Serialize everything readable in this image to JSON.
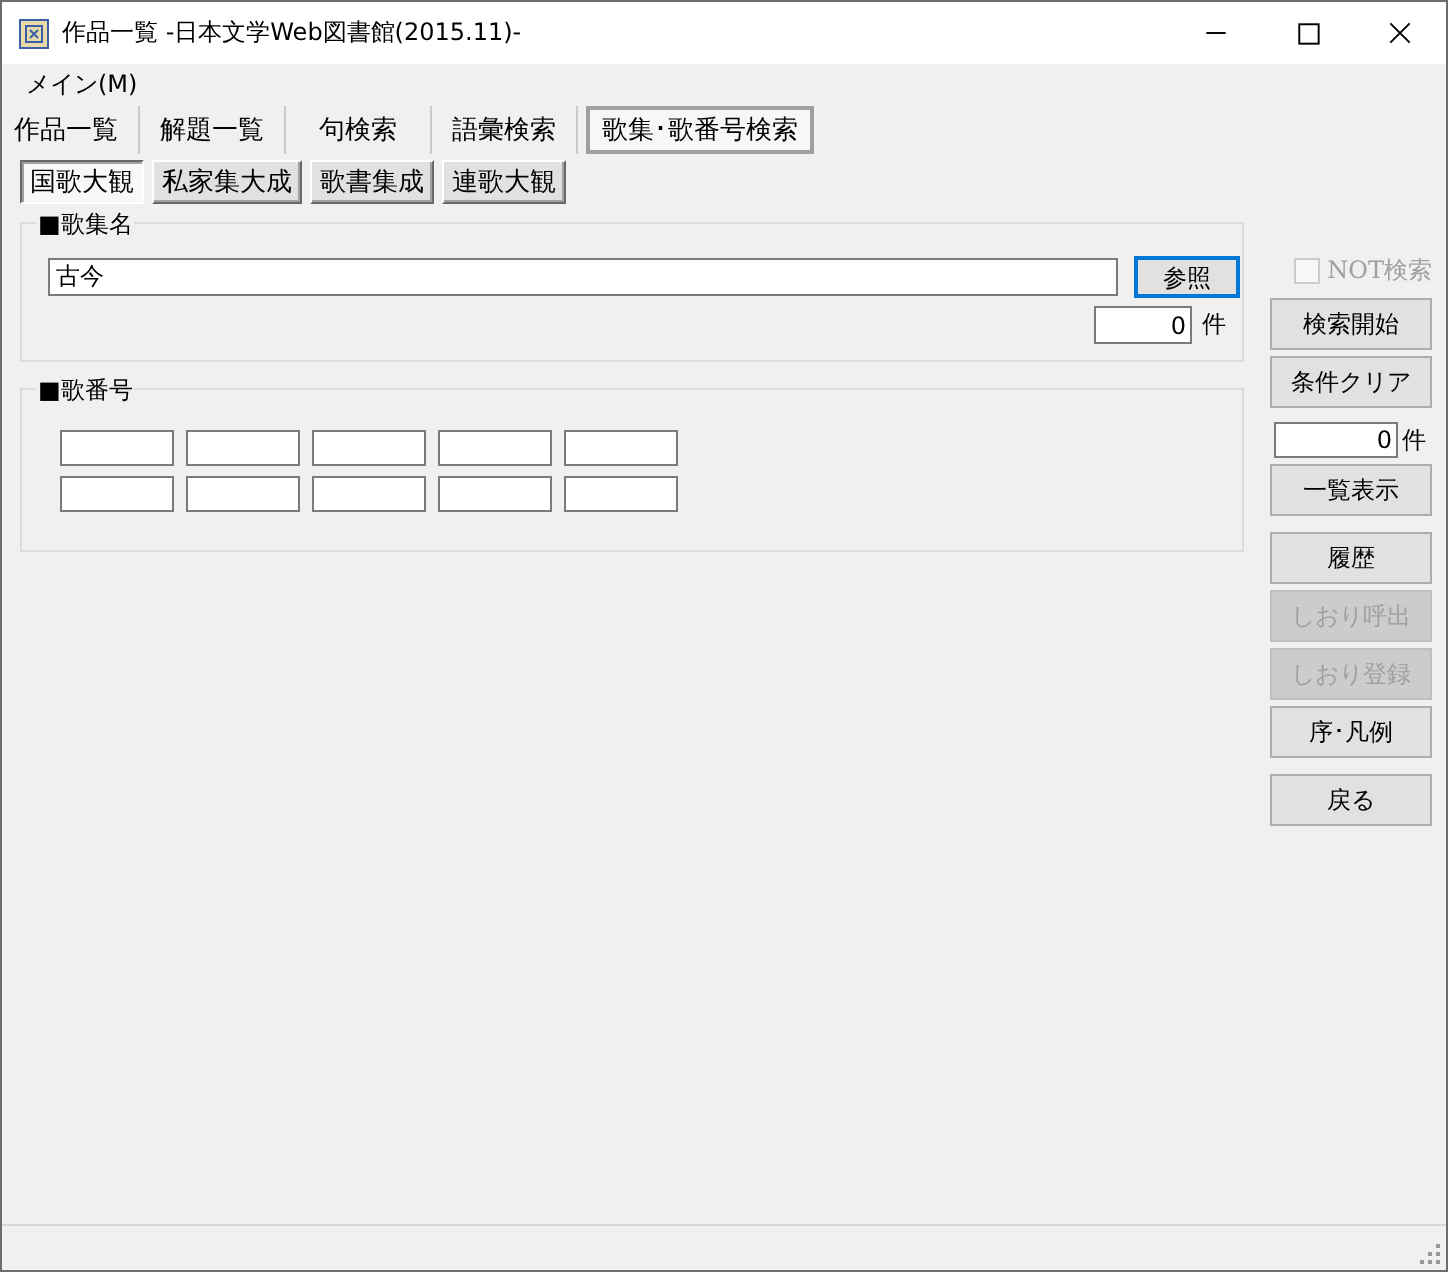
{
  "window": {
    "title": "作品一覧 -日本文学Web図書館(2015.11)-"
  },
  "menu": [
    {
      "label": "メイン(M)"
    }
  ],
  "tabs": [
    {
      "label": "作品一覧",
      "selected": false
    },
    {
      "label": "解題一覧",
      "selected": false
    },
    {
      "label": "句検索",
      "selected": false
    },
    {
      "label": "語彙検索",
      "selected": false
    },
    {
      "label": "歌集･歌番号検索",
      "selected": true
    }
  ],
  "sub_tabs": [
    {
      "label": "国歌大観",
      "selected": true
    },
    {
      "label": "私家集大成",
      "selected": false
    },
    {
      "label": "歌書集成",
      "selected": false
    },
    {
      "label": "連歌大観",
      "selected": false
    }
  ],
  "collection_group": {
    "title": "■歌集名",
    "value": "古今",
    "browse_button": "参照",
    "count": "0",
    "unit": "件"
  },
  "number_group": {
    "title": "■歌番号"
  },
  "side": {
    "not_search": {
      "label": "NOT検索",
      "checked": false,
      "disabled": true
    },
    "groups": [
      [
        {
          "kind": "button",
          "label": "検索開始",
          "disabled": false
        },
        {
          "kind": "button",
          "label": "条件クリア",
          "disabled": false
        },
        {
          "kind": "count",
          "value": "0",
          "unit": "件"
        },
        {
          "kind": "button",
          "label": "一覧表示",
          "disabled": false
        }
      ],
      [
        {
          "kind": "button",
          "label": "履歴",
          "disabled": false
        },
        {
          "kind": "button",
          "label": "しおり呼出",
          "disabled": true
        },
        {
          "kind": "button",
          "label": "しおり登録",
          "disabled": true
        },
        {
          "kind": "button",
          "label": "序･凡例",
          "disabled": false
        }
      ],
      [
        {
          "kind": "button",
          "label": "戻る",
          "disabled": false
        }
      ]
    ]
  }
}
